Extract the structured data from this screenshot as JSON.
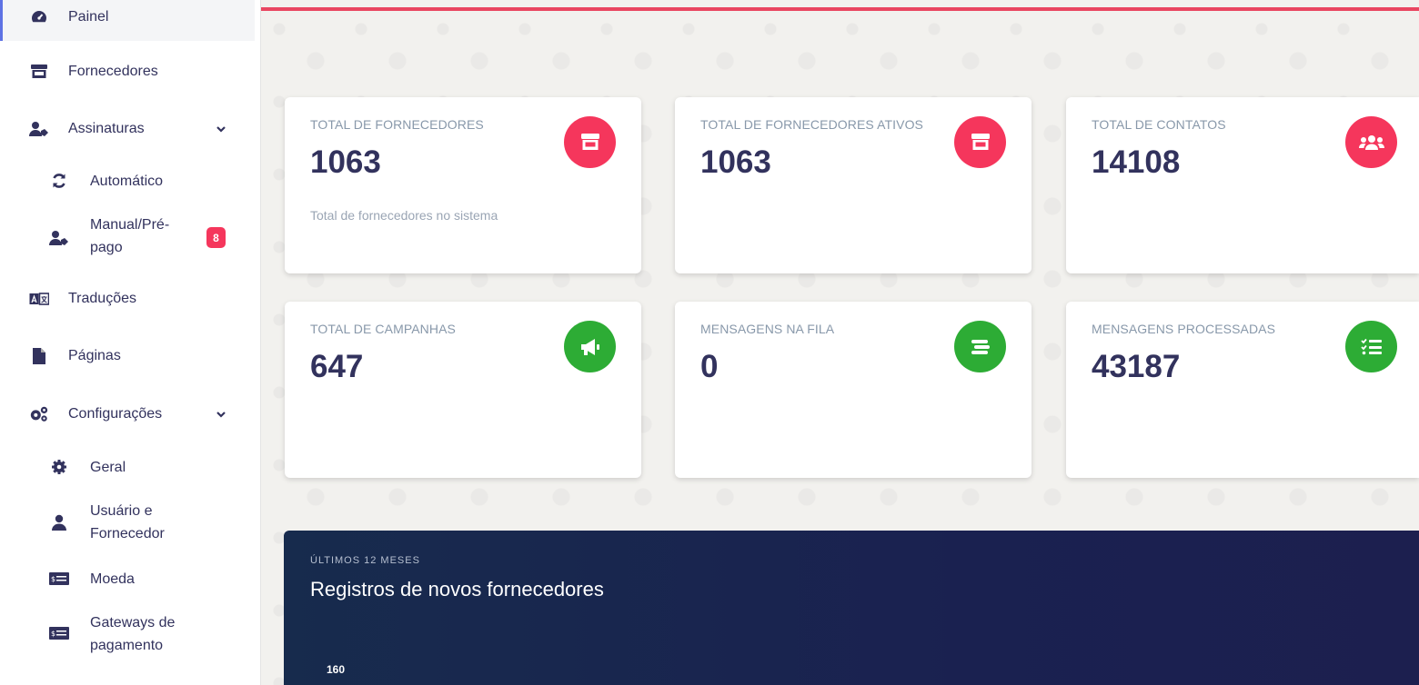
{
  "sidebar": {
    "items": [
      {
        "label": "Painel",
        "icon": "gauge-icon"
      },
      {
        "label": "Fornecedores",
        "icon": "store-icon"
      },
      {
        "label": "Assinaturas",
        "icon": "user-tag-icon"
      },
      {
        "label": "Automático",
        "icon": "sync-icon"
      },
      {
        "label": "Manual/Pré-pago",
        "label_line1": "Manual/Pré-",
        "label_line2": "pago",
        "icon": "user-tag-icon",
        "badge": "8"
      },
      {
        "label": "Traduções",
        "icon": "language-icon"
      },
      {
        "label": "Páginas",
        "icon": "file-icon"
      },
      {
        "label": "Configurações",
        "icon": "cogs-icon"
      },
      {
        "label": "Geral",
        "icon": "gear-icon"
      },
      {
        "label": "Usuário e Fornecedor",
        "label_line1": "Usuário e",
        "label_line2": "Fornecedor",
        "icon": "user-icon"
      },
      {
        "label": "Moeda",
        "icon": "money-icon"
      },
      {
        "label": "Gateways de pagamento",
        "label_line1": "Gateways de",
        "label_line2": "pagamento",
        "icon": "money-icon"
      }
    ]
  },
  "stats": [
    {
      "title": "TOTAL DE FORNECEDORES",
      "value": "1063",
      "sub": "Total de fornecedores no sistema",
      "icon": "store-icon",
      "color": "#f5365c"
    },
    {
      "title": "TOTAL DE FORNECEDORES ATIVOS",
      "value": "1063",
      "icon": "store-icon",
      "color": "#f5365c"
    },
    {
      "title": "TOTAL DE CONTATOS",
      "value": "14108",
      "icon": "users-icon",
      "color": "#f5365c"
    },
    {
      "title": "TOTAL DE CAMPANHAS",
      "value": "647",
      "icon": "megaphone-icon",
      "color": "#2dac35"
    },
    {
      "title": "MENSAGENS NA FILA",
      "value": "0",
      "icon": "list-icon",
      "color": "#2dac35"
    },
    {
      "title": "MENSAGENS PROCESSADAS",
      "value": "43187",
      "icon": "tasks-icon",
      "color": "#2dac35"
    }
  ],
  "chart": {
    "eyebrow": "ÚLTIMOS 12 MESES",
    "title": "Registros de novos fornecedores",
    "ytick_top": "160"
  },
  "colors": {
    "accent": "#e94560",
    "primary": "#5e72e4",
    "text": "#32325d"
  }
}
